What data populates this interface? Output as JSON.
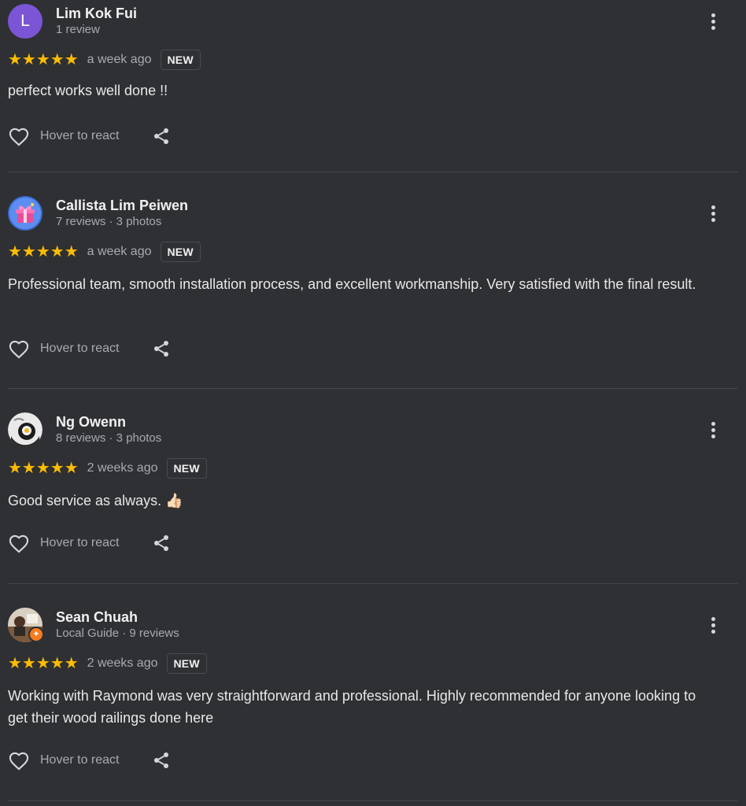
{
  "reviews": [
    {
      "avatar_letter": "L",
      "name": "Lim Kok Fui",
      "sub": "1 review",
      "rating": 5,
      "stars": "★★★★★",
      "time": "a week ago",
      "badge": "NEW",
      "text": "perfect works well done !!",
      "react_label": "Hover to react"
    },
    {
      "name": "Callista Lim Peiwen",
      "sub": "7 reviews · 3 photos",
      "rating": 5,
      "stars": "★★★★★",
      "time": "a week ago",
      "badge": "NEW",
      "text": "Professional team, smooth installation process, and excellent workmanship. Very satisfied with the final result.",
      "react_label": "Hover to react"
    },
    {
      "name": "Ng Owenn",
      "sub": "8 reviews · 3 photos",
      "rating": 5,
      "stars": "★★★★★",
      "time": "2 weeks ago",
      "badge": "NEW",
      "text": "Good service as always. 👍🏻",
      "react_label": "Hover to react"
    },
    {
      "name": "Sean Chuah",
      "sub": "Local Guide · 9 reviews",
      "rating": 5,
      "stars": "★★★★★",
      "time": "2 weeks ago",
      "badge": "NEW",
      "text": "Working with Raymond was very straightforward and professional. Highly recommended for anyone looking to get their wood railings done here",
      "react_label": "Hover to react"
    }
  ],
  "colors": {
    "background": "#2f3034",
    "star": "#fbbc04",
    "avatar_letter_bg": "#7b55d6"
  },
  "icons": [
    "heart-outline-icon",
    "share-icon",
    "more-vertical-icon"
  ]
}
